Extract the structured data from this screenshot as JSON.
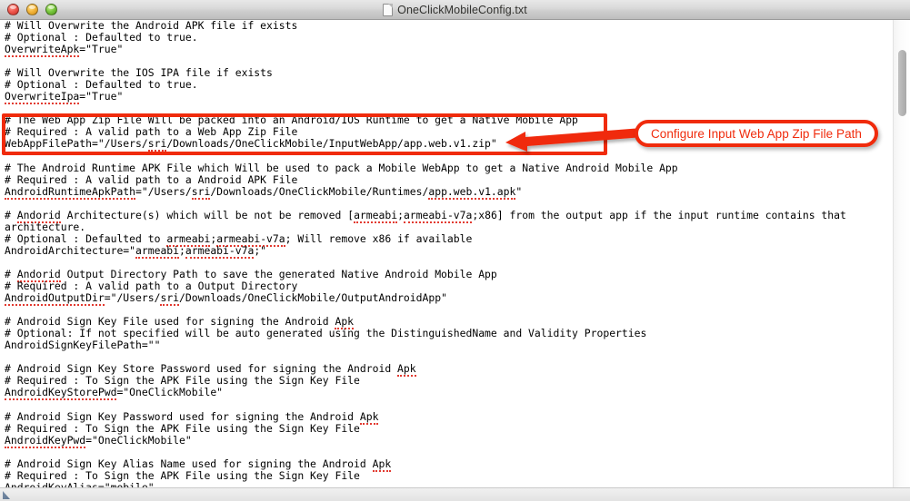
{
  "window": {
    "title": "OneClickMobileConfig.txt",
    "doc_icon": "document-icon",
    "controls": {
      "close": "close-button",
      "minimize": "minimize-button",
      "zoom": "zoom-button"
    }
  },
  "annotation": {
    "callout_label": "Configure Input Web App Zip File Path",
    "accent_color": "#f02b0c",
    "arrow": "left-pointing-arrow",
    "highlight_target": "WebAppFilePath"
  },
  "editor": {
    "font": "monospace",
    "spellcheck_underline_color": "#e23a30",
    "scrollbar": {
      "thumb_color": "#b4b4b4",
      "position": "top"
    },
    "lines": [
      "# Will Overwrite the Android APK file if exists",
      "# Optional : Defaulted to true.",
      "OverwriteApk=\"True\"",
      "",
      "# Will Overwrite the IOS IPA file if exists",
      "# Optional : Defaulted to true.",
      "OverwriteIpa=\"True\"",
      "",
      "# The Web App Zip File Will be packed into an Android/IOS Runtime to get a Native Mobile App",
      "# Required : A valid path to a Web App Zip File",
      "WebAppFilePath=\"/Users/sri/Downloads/OneClickMobile/InputWebApp/app.web.v1.zip\"",
      "",
      "# The Android Runtime APK File which Will be used to pack a Mobile WebApp to get a Native Android Mobile App",
      "# Required : A valid path to a Android APK File",
      "AndroidRuntimeApkPath=\"/Users/sri/Downloads/OneClickMobile/Runtimes/app.web.v1.apk\"",
      "",
      "# Andorid Architecture(s) which will be not be removed [armeabi;armeabi-v7a;x86] from the output app if the input runtime contains that architecture.",
      "# Optional : Defaulted to armeabi;armeabi-v7a; Will remove x86 if available",
      "AndroidArchitecture=\"armeabi;armeabi-v7a;\"",
      "",
      "# Andorid Output Directory Path to save the generated Native Android Mobile App",
      "# Required : A valid path to a Output Directory",
      "AndroidOutputDir=\"/Users/sri/Downloads/OneClickMobile/OutputAndroidApp\"",
      "",
      "# Android Sign Key File used for signing the Android Apk",
      "# Optional: If not specified will be auto generated using the DistinguishedName and Validity Properties",
      "AndroidSignKeyFilePath=\"\"",
      "",
      "# Android Sign Key Store Password used for signing the Android Apk",
      "# Required : To Sign the APK File using the Sign Key File",
      "AndroidKeyStorePwd=\"OneClickMobile\"",
      "",
      "# Android Sign Key Password used for signing the Android Apk",
      "# Required : To Sign the APK File using the Sign Key File",
      "AndroidKeyPwd=\"OneClickMobile\"",
      "",
      "# Android Sign Key Alias Name used for signing the Android Apk",
      "# Required : To Sign the APK File using the Sign Key File",
      "AndroidKeyAlias=\"mobile\""
    ],
    "misspelled_tokens": [
      "OverwriteApk",
      "OverwriteIpa",
      "AndroidRuntimeApkPath",
      "app.web.v1.apk",
      "Andorid",
      "armeabi",
      "armeabi-v7a",
      "AndroidOutputDir",
      "sri",
      "Apk",
      "AndroidKeyStorePwd",
      "AndroidKeyPwd",
      "AndroidKeyAlias"
    ]
  }
}
